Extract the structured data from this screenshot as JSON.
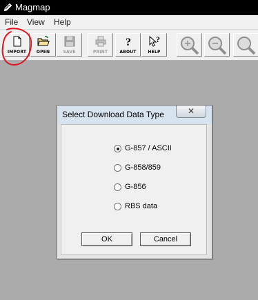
{
  "window": {
    "title": "Magmap",
    "icon": "pencil-icon"
  },
  "menu": {
    "items": [
      "File",
      "View",
      "Help"
    ]
  },
  "toolbar": {
    "buttons": [
      {
        "label": "IMPORT",
        "icon": "new-document-icon",
        "enabled": true
      },
      {
        "label": "OPEN",
        "icon": "open-folder-icon",
        "enabled": true
      },
      {
        "label": "SAVE",
        "icon": "floppy-disk-icon",
        "enabled": false
      },
      {
        "label": "PRINT",
        "icon": "printer-icon",
        "enabled": false
      },
      {
        "label": "ABOUT",
        "icon": "question-mark-icon",
        "enabled": true
      },
      {
        "label": "HELP",
        "icon": "help-pointer-icon",
        "enabled": true
      }
    ],
    "zoom_buttons": [
      "zoom-in-icon",
      "zoom-out-icon",
      "zoom-icon"
    ]
  },
  "annotation": {
    "type": "red-circle",
    "target": "IMPORT",
    "color": "#e0141e"
  },
  "dialog": {
    "title": "Select Download Data Type",
    "close_icon": "close-icon",
    "options": [
      {
        "label": "G-857 / ASCII",
        "selected": true
      },
      {
        "label": "G-858/859",
        "selected": false
      },
      {
        "label": "G-856",
        "selected": false
      },
      {
        "label": "RBS data",
        "selected": false
      }
    ],
    "ok_label": "OK",
    "cancel_label": "Cancel"
  },
  "colors": {
    "workspace": "#ababab",
    "titlebar": "#000000",
    "dialog_title": "#d7e3ef"
  }
}
